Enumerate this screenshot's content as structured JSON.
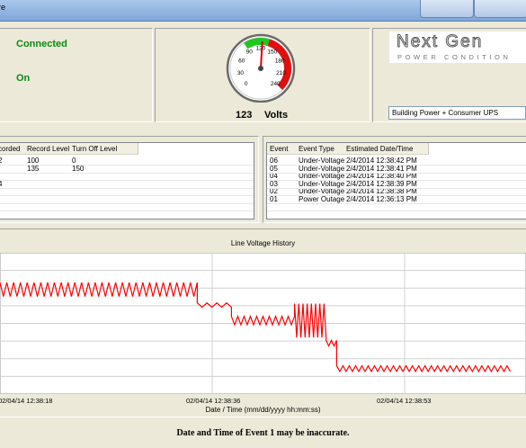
{
  "window": {
    "title_fragment": "re"
  },
  "status": {
    "connection": "Connected",
    "power": "On"
  },
  "gauge": {
    "value": 123,
    "unit": "Volts",
    "min": 0,
    "max": 240,
    "ticks": [
      "0",
      "30",
      "60",
      "90",
      "120",
      "150",
      "180",
      "210",
      "240"
    ],
    "green_range": [
      90,
      135
    ],
    "red_range": [
      135,
      240
    ]
  },
  "logo": {
    "brand": "Next Gen",
    "tagline": "POWER CONDITION"
  },
  "config": {
    "load_type": "Building Power + Consumer UPS"
  },
  "levels_table": {
    "columns": [
      "corded",
      "Record Level",
      "Turn Off Level"
    ],
    "rows": [
      [
        "2",
        "100",
        "0"
      ],
      [
        "",
        "135",
        "150"
      ],
      [
        "",
        "",
        ""
      ],
      [
        "4",
        "",
        ""
      ]
    ]
  },
  "events_table": {
    "columns": [
      "Event",
      "Event Type",
      "Estimated Date/Time"
    ],
    "rows": [
      [
        "06",
        "Under-Voltage",
        "2/4/2014 12:38:42 PM"
      ],
      [
        "05",
        "Under-Voltage",
        "2/4/2014 12:38:41 PM"
      ],
      [
        "04",
        "Under-Voltage",
        "2/4/2014 12:38:40 PM"
      ],
      [
        "03",
        "Under-Voltage",
        "2/4/2014 12:38:39 PM"
      ],
      [
        "02",
        "Under-Voltage",
        "2/4/2014 12:38:38 PM"
      ],
      [
        "01",
        "Power Outage",
        "2/4/2014 12:36:13 PM"
      ]
    ]
  },
  "chart_data": {
    "type": "line",
    "title": "Line Voltage History",
    "xlabel": "Date / Time (mm/dd/yyyy hh:mm:ss)",
    "x_ticks": [
      "02/04/14 12:38:18",
      "02/04/14 12:38:36",
      "02/04/14 12:38:53"
    ],
    "grid": true,
    "series": [
      {
        "color": "#ff0000",
        "segments": [
          {
            "x_start": 0.0,
            "x_end": 0.375,
            "y_base": 0.74,
            "amplitude": 0.05,
            "period": 0.013
          },
          {
            "x_start": 0.375,
            "x_end": 0.44,
            "y_base": 0.63,
            "amplitude": 0.015,
            "period": 0.02
          },
          {
            "x_start": 0.44,
            "x_end": 0.56,
            "y_base": 0.52,
            "amplitude": 0.03,
            "period": 0.012
          },
          {
            "x_start": 0.56,
            "x_end": 0.62,
            "y_base": 0.52,
            "amplitude": 0.12,
            "period": 0.008
          },
          {
            "x_start": 0.62,
            "x_end": 0.64,
            "y_base": 0.36,
            "amplitude": 0.02,
            "period": 0.01
          },
          {
            "x_start": 0.64,
            "x_end": 0.97,
            "y_base": 0.18,
            "amplitude": 0.02,
            "period": 0.012
          }
        ]
      }
    ]
  },
  "footer": {
    "message": "Date and Time of Event 1 may be inaccurate."
  }
}
